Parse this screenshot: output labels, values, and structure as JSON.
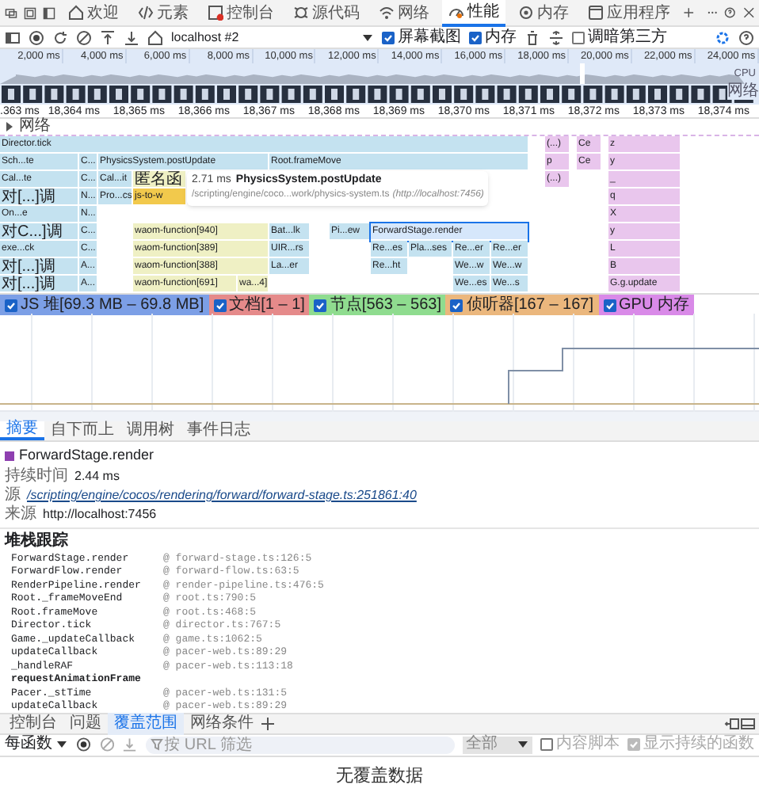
{
  "main_tabs": [
    {
      "label": "欢迎",
      "selected": false
    },
    {
      "label": "元素",
      "selected": false
    },
    {
      "label": "控制台",
      "selected": false
    },
    {
      "label": "源代码",
      "selected": false
    },
    {
      "label": "网络",
      "selected": false
    },
    {
      "label": "性能",
      "selected": true
    },
    {
      "label": "内存",
      "selected": false
    },
    {
      "label": "应用程序",
      "selected": false
    }
  ],
  "toolbar": {
    "target": "localhost #2",
    "checkboxes": [
      {
        "label": "屏幕截图",
        "checked": true
      },
      {
        "label": "内存",
        "checked": true
      },
      {
        "label": "调暗第三方",
        "checked": false
      }
    ]
  },
  "overview": {
    "ticks": [
      "2,000 ms",
      "4,000 ms",
      "6,000 ms",
      "8,000 ms",
      "10,000 ms",
      "12,000 ms",
      "14,000 ms",
      "16,000 ms",
      "18,000 ms",
      "20,000 ms",
      "22,000 ms",
      "24,000 ms"
    ],
    "cpu_label": "CPU",
    "network_label": "网络"
  },
  "ruler": [
    ".363 ms",
    "18,364 ms",
    "18,365 ms",
    "18,366 ms",
    "18,367 ms",
    "18,368 ms",
    "18,369 ms",
    "18,370 ms",
    "18,371 ms",
    "18,372 ms",
    "18,373 ms",
    "18,374 ms"
  ],
  "network_track": {
    "label": "网络",
    "expanded": false
  },
  "flame_rows": [
    [
      {
        "text": "Director.tick",
        "kind": "js",
        "selected": false
      },
      {
        "text": "(...)",
        "kind": "other",
        "selected": false
      },
      {
        "text": "Ce",
        "kind": "other",
        "selected": false
      },
      {
        "text": "z",
        "kind": "other",
        "selected": false
      }
    ],
    [
      {
        "text": "Sch...te",
        "kind": "js",
        "selected": false
      },
      {
        "text": "C...",
        "kind": "js",
        "selected": false
      },
      {
        "text": "PhysicsSystem.postUpdate",
        "kind": "js",
        "selected": false
      },
      {
        "text": "Root.frameMove",
        "kind": "js",
        "selected": false
      },
      {
        "text": "p",
        "kind": "other",
        "selected": false
      },
      {
        "text": "Ce",
        "kind": "other",
        "selected": false
      },
      {
        "text": "y",
        "kind": "other",
        "selected": false
      }
    ],
    [
      {
        "text": "Cal...te",
        "kind": "js",
        "selected": false
      },
      {
        "text": "C...",
        "kind": "js",
        "selected": false
      },
      {
        "text": "Cal...it",
        "kind": "js",
        "selected": false
      },
      {
        "text": "匿名函",
        "kind": "wasm",
        "selected": false
      },
      {
        "text": "(...)",
        "kind": "other",
        "selected": false
      },
      {
        "text": "_",
        "kind": "other",
        "selected": false
      }
    ],
    [
      {
        "text": "对[...]调",
        "kind": "js",
        "selected": false
      },
      {
        "text": "N...",
        "kind": "js",
        "selected": false
      },
      {
        "text": "Pro...cs",
        "kind": "js",
        "selected": false
      },
      {
        "text": "js-to-w",
        "kind": "native",
        "selected": false
      },
      {
        "text": "q",
        "kind": "other",
        "selected": false
      }
    ],
    [
      {
        "text": "On...e",
        "kind": "js",
        "selected": false
      },
      {
        "text": "N...",
        "kind": "js",
        "selected": false
      },
      {
        "text": "X",
        "kind": "other",
        "selected": false
      }
    ],
    [
      {
        "text": "对C...]调",
        "kind": "js",
        "selected": false
      },
      {
        "text": "C...",
        "kind": "js",
        "selected": false
      },
      {
        "text": "waom-function[940]",
        "kind": "wasm",
        "selected": false
      },
      {
        "text": "Bat...lk",
        "kind": "js",
        "selected": false
      },
      {
        "text": "Pi...ew",
        "kind": "js",
        "selected": false
      },
      {
        "text": "ForwardStage.render",
        "kind": "js",
        "selected": true
      },
      {
        "text": "y",
        "kind": "other",
        "selected": false
      }
    ],
    [
      {
        "text": "exe...ck",
        "kind": "js",
        "selected": false
      },
      {
        "text": "C...",
        "kind": "js",
        "selected": false
      },
      {
        "text": "waom-function[389]",
        "kind": "wasm",
        "selected": false
      },
      {
        "text": "UIR...rs",
        "kind": "js",
        "selected": false
      },
      {
        "text": "Re...es",
        "kind": "js",
        "selected": false
      },
      {
        "text": "Pla...ses",
        "kind": "js",
        "selected": false
      },
      {
        "text": "Re...er",
        "kind": "js",
        "selected": false
      },
      {
        "text": "Re...er",
        "kind": "js",
        "selected": false
      },
      {
        "text": "L",
        "kind": "other",
        "selected": false
      }
    ],
    [
      {
        "text": "对[...]调",
        "kind": "js",
        "selected": false
      },
      {
        "text": "A...",
        "kind": "js",
        "selected": false
      },
      {
        "text": "waom-function[388]",
        "kind": "wasm",
        "selected": false
      },
      {
        "text": "La...er",
        "kind": "js",
        "selected": false
      },
      {
        "text": "Re...ht",
        "kind": "js",
        "selected": false
      },
      {
        "text": "We...w",
        "kind": "js",
        "selected": false
      },
      {
        "text": "We...w",
        "kind": "js",
        "selected": false
      },
      {
        "text": "B",
        "kind": "other",
        "selected": false
      }
    ],
    [
      {
        "text": "对[...]调",
        "kind": "js",
        "selected": false
      },
      {
        "text": "A...",
        "kind": "js",
        "selected": false
      },
      {
        "text": "waom-function[691]",
        "kind": "wasm",
        "selected": false
      },
      {
        "text": "wa...4]",
        "kind": "wasm",
        "selected": false
      },
      {
        "text": "We...es",
        "kind": "js",
        "selected": false
      },
      {
        "text": "We...s",
        "kind": "js",
        "selected": false
      },
      {
        "text": "G.g.update",
        "kind": "other",
        "selected": false
      }
    ]
  ],
  "tooltip": {
    "duration": "2.71 ms",
    "name": "PhysicsSystem.postUpdate",
    "path": "/scripting/engine/coco...work/physics-system.ts",
    "origin": "(http://localhost:7456)"
  },
  "counters": [
    {
      "label": "JS 堆[69.3 MB – 69.8 MB]",
      "checked": true,
      "color": "#7c9fe6"
    },
    {
      "label": "文档[1 – 1]",
      "checked": true,
      "color": "#e58a8a"
    },
    {
      "label": "节点[563 – 563]",
      "checked": true,
      "color": "#8fdc8f"
    },
    {
      "label": "侦听器[167 – 167]",
      "checked": true,
      "color": "#ebb77d"
    },
    {
      "label": "GPU 内存",
      "checked": true,
      "color": "#d98ae8"
    }
  ],
  "detail_tabs": [
    {
      "label": "摘要",
      "selected": true
    },
    {
      "label": "自下而上",
      "selected": false
    },
    {
      "label": "调用树",
      "selected": false
    },
    {
      "label": "事件日志",
      "selected": false
    }
  ],
  "summary": {
    "title": "ForwardStage.render",
    "color": "#8e3fb0",
    "fields": [
      {
        "label": "持续时间",
        "value": "2.44 ms",
        "kind": "text"
      },
      {
        "label": "源",
        "value": "/scripting/engine/cocos/rendering/forward/forward-stage.ts:251861:40",
        "kind": "link"
      },
      {
        "label": "来源",
        "value": "http://localhost:7456",
        "kind": "text"
      }
    ]
  },
  "stack": {
    "title": "堆栈跟踪",
    "frames": [
      {
        "fn": "ForwardStage.render",
        "loc": "@ forward-stage.ts:126:5"
      },
      {
        "fn": "ForwardFlow.render",
        "loc": "@ forward-flow.ts:63:5"
      },
      {
        "fn": "RenderPipeline.render",
        "loc": "@ render-pipeline.ts:476:5"
      },
      {
        "fn": "Root._frameMoveEnd",
        "loc": "@ root.ts:790:5"
      },
      {
        "fn": "Root.frameMove",
        "loc": "@ root.ts:468:5"
      },
      {
        "fn": "Director.tick",
        "loc": "@ director.ts:767:5"
      },
      {
        "fn": "Game._updateCallback",
        "loc": "@ game.ts:1062:5"
      },
      {
        "fn": "updateCallback",
        "loc": "@ pacer-web.ts:89:29"
      },
      {
        "fn": "_handleRAF",
        "loc": "@ pacer-web.ts:113:18"
      },
      {
        "fn": "requestAnimationFrame"
      },
      {
        "fn": "Pacer._stTime",
        "loc": "@ pacer-web.ts:131:5"
      },
      {
        "fn": "updateCallback",
        "loc": "@ pacer-web.ts:89:29"
      }
    ]
  },
  "drawer_tabs": [
    {
      "label": "控制台",
      "selected": false
    },
    {
      "label": "问题",
      "selected": false
    },
    {
      "label": "覆盖范围",
      "selected": true
    },
    {
      "label": "网络条件",
      "selected": false
    }
  ],
  "coverage": {
    "mode": "每函数",
    "filter_placeholder": "按 URL 筛选",
    "type": "全部",
    "options": [
      {
        "label": "内容脚本",
        "checked": false
      },
      {
        "label": "显示持续的函数",
        "checked": true
      }
    ],
    "empty": "无覆盖数据"
  }
}
